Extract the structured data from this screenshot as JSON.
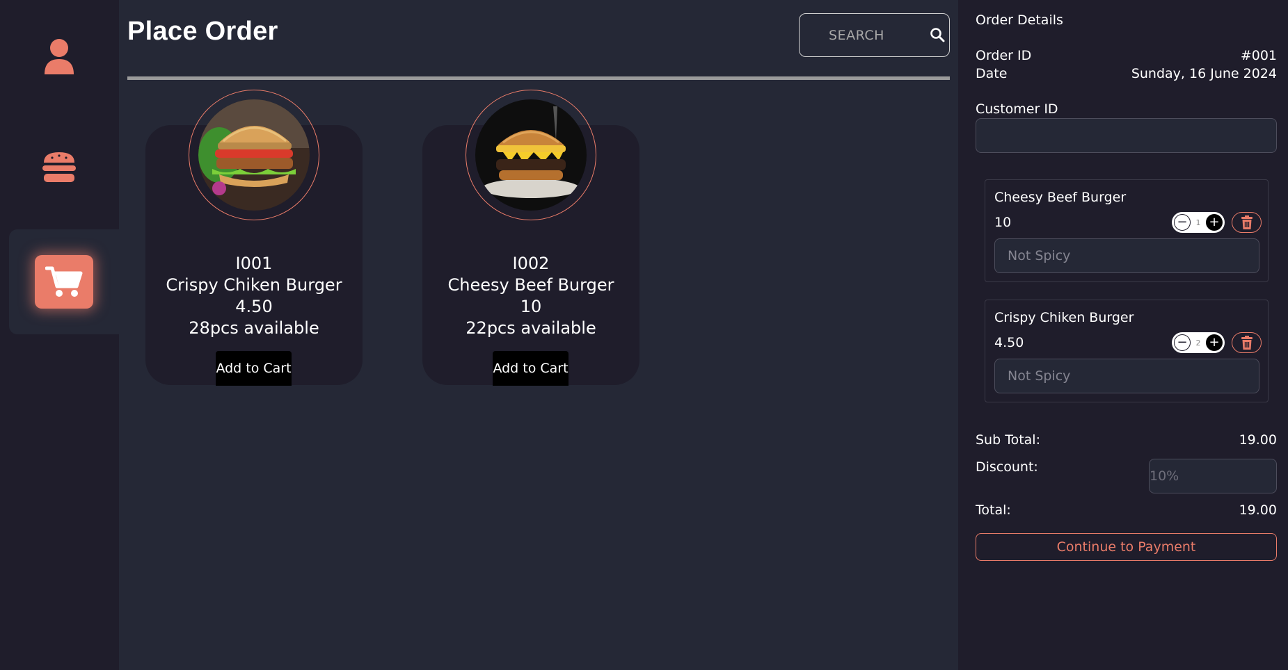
{
  "page": {
    "title": "Place Order"
  },
  "sidebar": {
    "items": [
      {
        "name": "profile",
        "icon": "user-icon"
      },
      {
        "name": "menu",
        "icon": "burger-icon"
      },
      {
        "name": "cart",
        "icon": "cart-icon",
        "active": true
      }
    ]
  },
  "search": {
    "placeholder": "SEARCH",
    "icon": "search-icon"
  },
  "products": [
    {
      "id": "I001",
      "name": "Crispy Chiken Burger",
      "price": "4.50",
      "stock": "28pcs available",
      "button": "Add to Cart"
    },
    {
      "id": "I002",
      "name": "Cheesy Beef Burger",
      "price": "10",
      "stock": "22pcs available",
      "button": "Add to Cart"
    }
  ],
  "order": {
    "title": "Order Details",
    "order_id_label": "Order ID",
    "order_id": "#001",
    "date_label": "Date",
    "date": "Sunday, 16 June 2024",
    "customer_label": "Customer ID",
    "customer_value": "",
    "items": [
      {
        "name": "Cheesy Beef Burger",
        "price": "10",
        "qty": "1",
        "note_placeholder": "Not Spicy"
      },
      {
        "name": "Crispy Chiken Burger",
        "price": "4.50",
        "qty": "2",
        "note_placeholder": "Not Spicy"
      }
    ],
    "subtotal_label": "Sub Total:",
    "subtotal": "19.00",
    "discount_label": "Discount:",
    "discount_placeholder": "10%",
    "total_label": "Total:",
    "total": "19.00",
    "pay_button": "Continue to Payment"
  },
  "colors": {
    "accent": "#ea7c69",
    "background": "#252836",
    "panel": "#1f1d2b"
  }
}
